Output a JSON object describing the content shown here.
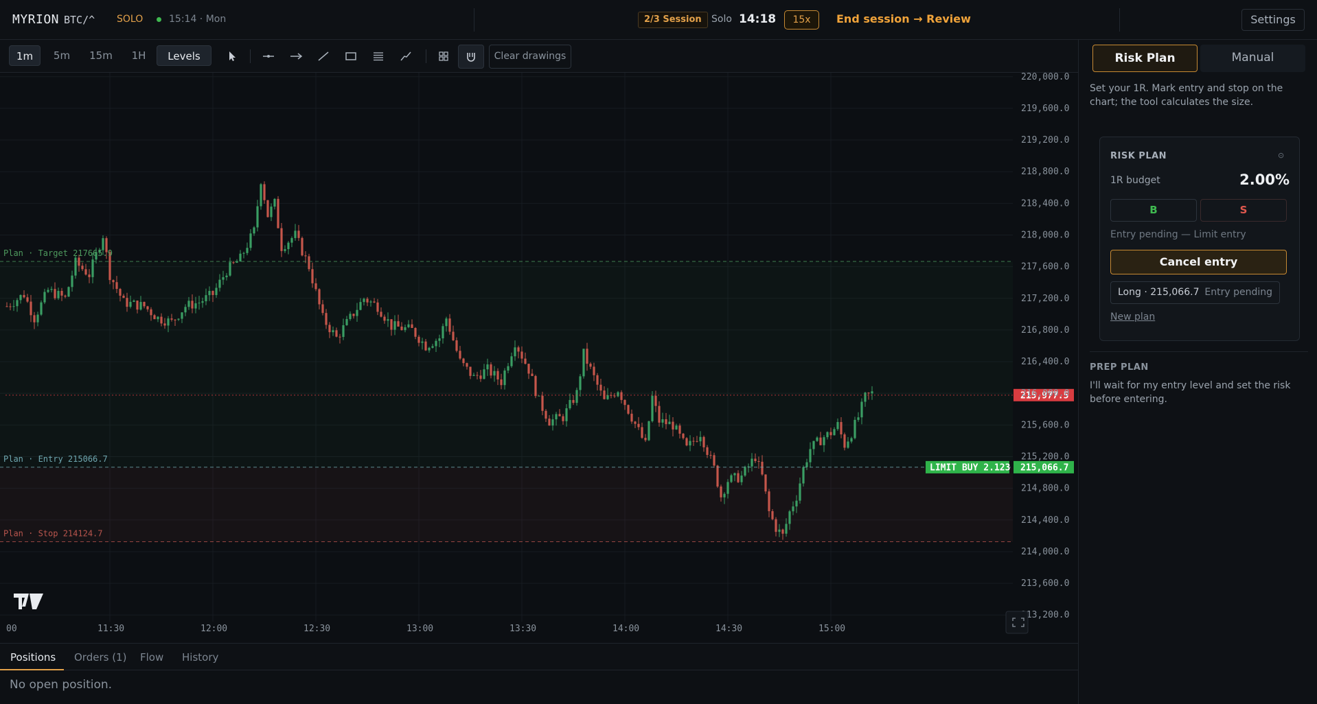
{
  "header": {
    "logo": "MYRION",
    "symbol": "BTC/^",
    "mode": "SOLO",
    "clock": "15:14 · Mon",
    "session_badge": "2/3 Session",
    "solo_label": "Solo",
    "timer": "14:18",
    "speed": "15x",
    "end_session": "End session → Review",
    "settings": "Settings"
  },
  "toolbar": {
    "timeframes": [
      "1m",
      "5m",
      "15m",
      "1H",
      "Levels"
    ],
    "active_timeframe": "1m",
    "clear_drawings": "Clear drawings",
    "tools": [
      "cursor-icon",
      "horizontal-ray-icon",
      "arrow-line-icon",
      "trend-line-icon",
      "rectangle-icon",
      "fib-levels-icon",
      "path-icon",
      "layout-grid-icon",
      "magnet-icon"
    ]
  },
  "colors": {
    "up": "#3a9d63",
    "down": "#c5564b",
    "target": "#3fb950",
    "entry": "#4fa0a8",
    "stop": "#d05a50",
    "accent": "#e3a14a",
    "last_price_tag": "#d83c40",
    "limit_tag": "#2fb34a"
  },
  "chart_data": {
    "type": "candlestick",
    "y_axis_labels": [
      "220,000.0",
      "219,600.0",
      "219,200.0",
      "218,800.0",
      "218,400.0",
      "218,000.0",
      "217,600.0",
      "217,200.0",
      "216,800.0",
      "216,400.0",
      "216,000.0",
      "215,600.0",
      "215,200.0",
      "214,800.0",
      "214,400.0",
      "214,000.0",
      "213,600.0",
      "213,200.0"
    ],
    "y_ticks": [
      220000,
      219600,
      219200,
      218800,
      218400,
      218000,
      217600,
      217200,
      216800,
      216400,
      216000,
      215600,
      215200,
      214800,
      214400,
      214000,
      213600,
      213200
    ],
    "ylim": [
      213150,
      220050
    ],
    "x_axis_labels": [
      "00",
      "11:30",
      "12:00",
      "12:30",
      "13:00",
      "13:30",
      "14:00",
      "14:30",
      "15:00"
    ],
    "x_label_minutes": [
      -1,
      30,
      60,
      90,
      120,
      150,
      180,
      210,
      240
    ],
    "x_start": "11:00",
    "x_end": "15:04",
    "price_path": [
      [
        0,
        217100
      ],
      [
        5,
        217250
      ],
      [
        8,
        216950
      ],
      [
        12,
        217300
      ],
      [
        17,
        217200
      ],
      [
        20,
        217650
      ],
      [
        24,
        217500
      ],
      [
        28,
        218000
      ],
      [
        30,
        217500
      ],
      [
        34,
        217150
      ],
      [
        40,
        217100
      ],
      [
        44,
        216950
      ],
      [
        48,
        216900
      ],
      [
        52,
        217100
      ],
      [
        56,
        217150
      ],
      [
        60,
        217250
      ],
      [
        64,
        217550
      ],
      [
        68,
        217700
      ],
      [
        72,
        218050
      ],
      [
        74,
        218700
      ],
      [
        76,
        218250
      ],
      [
        78,
        218400
      ],
      [
        80,
        217850
      ],
      [
        84,
        218000
      ],
      [
        88,
        217600
      ],
      [
        92,
        216950
      ],
      [
        96,
        216700
      ],
      [
        100,
        216950
      ],
      [
        104,
        217200
      ],
      [
        108,
        217100
      ],
      [
        112,
        216850
      ],
      [
        118,
        216800
      ],
      [
        122,
        216600
      ],
      [
        126,
        216700
      ],
      [
        128,
        216950
      ],
      [
        132,
        216400
      ],
      [
        136,
        216200
      ],
      [
        140,
        216300
      ],
      [
        144,
        216150
      ],
      [
        148,
        216650
      ],
      [
        152,
        216300
      ],
      [
        155,
        215900
      ],
      [
        158,
        215650
      ],
      [
        162,
        215700
      ],
      [
        166,
        216000
      ],
      [
        168,
        216500
      ],
      [
        170,
        216300
      ],
      [
        174,
        215900
      ],
      [
        178,
        216050
      ],
      [
        182,
        215700
      ],
      [
        186,
        215350
      ],
      [
        188,
        215950
      ],
      [
        190,
        215650
      ],
      [
        194,
        215600
      ],
      [
        198,
        215300
      ],
      [
        202,
        215500
      ],
      [
        206,
        215050
      ],
      [
        208,
        214700
      ],
      [
        210,
        214900
      ],
      [
        214,
        214950
      ],
      [
        218,
        215200
      ],
      [
        220,
        214950
      ],
      [
        222,
        214500
      ],
      [
        224,
        214300
      ],
      [
        226,
        214200
      ],
      [
        228,
        214500
      ],
      [
        230,
        214700
      ],
      [
        232,
        215050
      ],
      [
        234,
        215300
      ],
      [
        238,
        215450
      ],
      [
        240,
        215500
      ],
      [
        242,
        215600
      ],
      [
        244,
        215350
      ],
      [
        246,
        215500
      ],
      [
        248,
        215700
      ],
      [
        250,
        215950
      ],
      [
        252,
        216000
      ]
    ],
    "levels": {
      "target": {
        "label": "Plan · Target 217665.9",
        "price": 217665.9
      },
      "entry": {
        "label": "Plan · Entry 215066.7",
        "price": 215066.7
      },
      "stop": {
        "label": "Plan · Stop 214124.7",
        "price": 214124.7
      },
      "last_price": {
        "label": "215,977.5",
        "price": 215977.5
      },
      "limit": {
        "label": "LIMIT BUY 2.123",
        "price_label": "215,066.7",
        "price": 215066.7
      }
    },
    "watermark": "TV"
  },
  "bottom": {
    "tabs": [
      "Positions",
      "Orders (1)",
      "Flow",
      "History"
    ],
    "active_tab": "Positions",
    "empty_message": "No open position."
  },
  "sidebar": {
    "tabs": [
      "Risk Plan",
      "Manual"
    ],
    "active_tab": "Risk Plan",
    "description": "Set your 1R. Mark entry and stop on the chart; the tool calculates the size.",
    "risk_card": {
      "title": "RISK PLAN",
      "info_icon": "⊙",
      "budget_label": "1R budget",
      "budget_value": "2.00%",
      "buy_label": "B",
      "sell_label": "S",
      "pending_text": "Entry pending — Limit entry",
      "cancel_label": "Cancel entry",
      "order_left": "Long · 215,066.7",
      "order_right": "Entry pending",
      "new_plan": "New plan"
    },
    "prep": {
      "title": "PREP PLAN",
      "text": "I'll wait for my entry level and set the risk before entering."
    }
  }
}
